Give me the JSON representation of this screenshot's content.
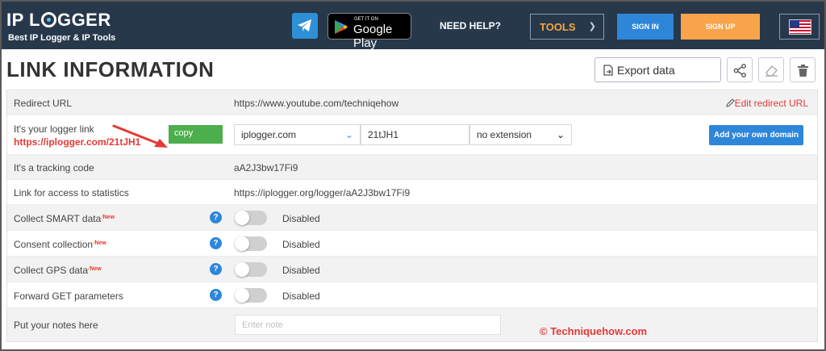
{
  "header": {
    "logo_text_pre": "IP L",
    "logo_text_post": "GGER",
    "tagline": "Best IP Logger & IP Tools",
    "google_play_small": "GET IT ON",
    "google_play_big": "Google Play",
    "need_help": "NEED HELP?",
    "tools": "TOOLS",
    "sign_in": "SIGN IN",
    "sign_up": "SIGN UP"
  },
  "page": {
    "title": "LINK INFORMATION",
    "export_label": "Export data"
  },
  "rows": {
    "redirect": {
      "label": "Redirect URL",
      "value": "https://www.youtube.com/techniqehow",
      "edit": "Edit redirect URL"
    },
    "logger": {
      "label": "It's your logger link",
      "link": "https://iplogger.com/21tJH1",
      "copy": "copy",
      "domain": "iplogger.com",
      "code": "21tJH1",
      "extension": "no extension",
      "add_domain": "Add your own domain"
    },
    "tracking": {
      "label": "It's a tracking code",
      "value": "aA2J3bw17Fi9"
    },
    "stats": {
      "label": "Link for access to statistics",
      "value": "https://iplogger.org/logger/aA2J3bw17Fi9"
    },
    "smart": {
      "label": "Collect SMART data",
      "badge": "New",
      "state": "Disabled"
    },
    "consent": {
      "label": "Consent collection",
      "badge": "New",
      "state": "Disabled"
    },
    "gps": {
      "label": "Collect GPS data",
      "badge": "New",
      "state": "Disabled"
    },
    "forward": {
      "label": "Forward GET parameters",
      "state": "Disabled"
    },
    "notes": {
      "label": "Put your notes here",
      "placeholder": "Enter note"
    }
  },
  "help_glyph": "?",
  "watermark": "© Techniquehow.com",
  "colors": {
    "header_bg": "#27384b",
    "accent_blue": "#2e86d9",
    "accent_orange": "#f9a34a",
    "link_red": "#e53935",
    "copy_green": "#4cae4c"
  }
}
